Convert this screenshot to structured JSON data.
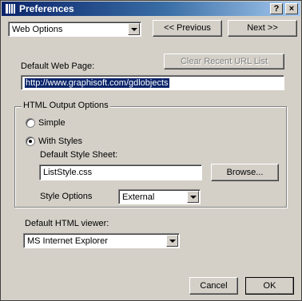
{
  "window": {
    "title": "Preferences",
    "help_label": "?",
    "close_label": "×"
  },
  "top": {
    "section_select": "Web Options",
    "previous_label": "<< Previous",
    "next_label": "Next >>"
  },
  "web": {
    "default_page_label": "Default Web Page:",
    "clear_recent_label": "Clear Recent URL List",
    "default_page_value": "http://www.graphisoft.com/gdlobjects"
  },
  "html_output": {
    "group_title": "HTML Output Options",
    "simple_label": "Simple",
    "with_styles_label": "With Styles",
    "style_sheet_label": "Default Style Sheet:",
    "style_sheet_value": "ListStyle.css",
    "browse_label": "Browse...",
    "style_options_label": "Style Options",
    "style_options_value": "External",
    "selected_option": "with_styles"
  },
  "viewer": {
    "label": "Default HTML viewer:",
    "value": "MS Internet Explorer"
  },
  "footer": {
    "cancel_label": "Cancel",
    "ok_label": "OK"
  },
  "colors": {
    "dialog_face": "#d4d0c8",
    "title_gradient_start": "#0a246a",
    "title_gradient_end": "#a6caf0",
    "selection": "#0a246a"
  }
}
